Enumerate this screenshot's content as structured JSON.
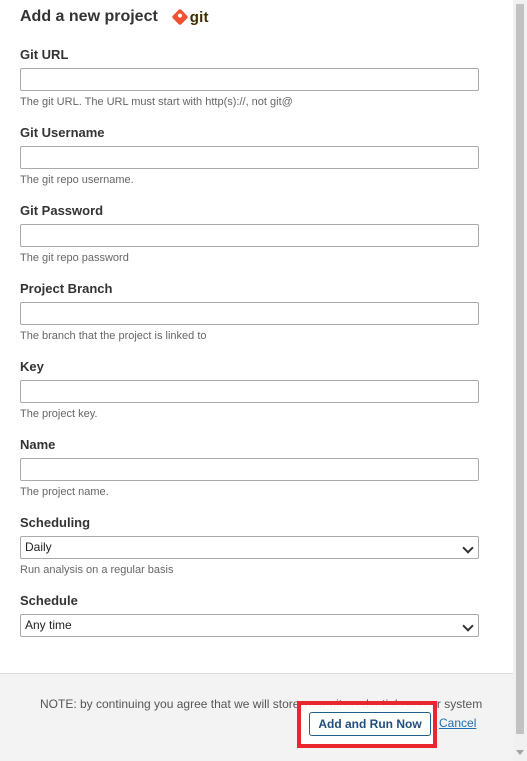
{
  "header": {
    "title": "Add a new project",
    "logo_text": "git",
    "logo_icon": "git-icon",
    "logo_color": "#f05133"
  },
  "fields": [
    {
      "label": "Git URL",
      "value": "",
      "help": "The git URL. The URL must start with http(s)://, not git@"
    },
    {
      "label": "Git Username",
      "value": "",
      "help": "The git repo username."
    },
    {
      "label": "Git Password",
      "value": "",
      "help": "The git repo password"
    },
    {
      "label": "Project Branch",
      "value": "",
      "help": "The branch that the project is linked to"
    },
    {
      "label": "Key",
      "value": "",
      "help": "The project key."
    },
    {
      "label": "Name",
      "value": "",
      "help": "The project name."
    }
  ],
  "scheduling": {
    "label": "Scheduling",
    "selected": "Daily",
    "help": "Run analysis on a regular basis"
  },
  "schedule": {
    "label": "Schedule",
    "selected": "Any time"
  },
  "footer": {
    "note": "NOTE: by continuing you agree that we will store your git credentials on our system",
    "run_label": "Add and Run Now",
    "cancel_label": "Cancel",
    "highlight_color": "#e8282e",
    "button_border_color": "#1f5f8b"
  }
}
